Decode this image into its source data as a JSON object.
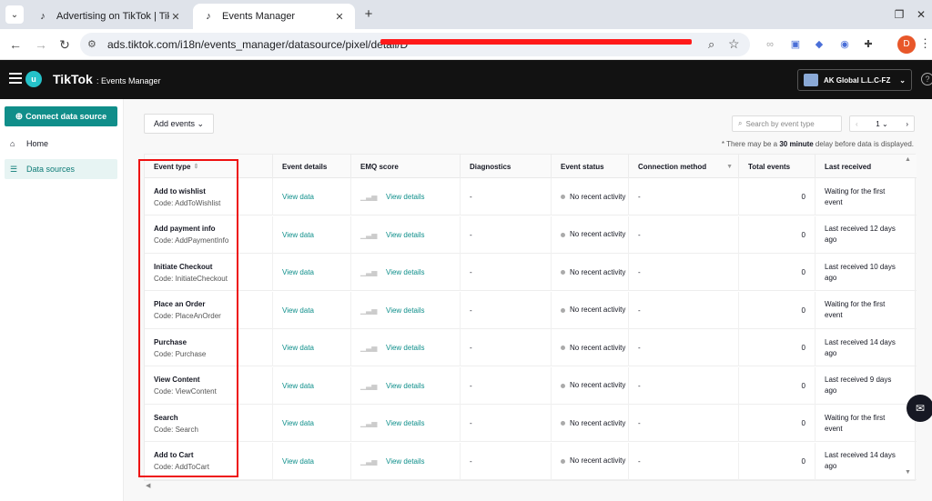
{
  "browser": {
    "tabs": [
      {
        "title": "Advertising on TikTok | TikTok A",
        "active": false
      },
      {
        "title": "Events Manager",
        "active": true
      }
    ],
    "url_host": "ads.tiktok.com",
    "url_path": "/i18n/events_manager/datasource/pixel/detail/D",
    "profile_initial": "D"
  },
  "header": {
    "brand": "TikTok",
    "brand_suffix": ": Events Manager",
    "account_name": "AK Global L.L.C-FZ"
  },
  "sidebar": {
    "connect_label": "Connect data source",
    "items": [
      {
        "label": "Home",
        "active": false
      },
      {
        "label": "Data sources",
        "active": true
      }
    ]
  },
  "toolbar": {
    "add_events_label": "Add events",
    "search_placeholder": "Search by event type",
    "page_number": "1"
  },
  "notice": {
    "prefix": "* There may be a ",
    "bold": "30 minute",
    "suffix": " delay before data is displayed."
  },
  "table": {
    "columns": [
      "Event type",
      "Event details",
      "EMQ score",
      "Diagnostics",
      "Event status",
      "Connection method",
      "Total events",
      "Last received"
    ],
    "rows": [
      {
        "name": "Add to wishlist",
        "code": "Code: AddToWishlist",
        "details": "View data",
        "emq": "View details",
        "diag": "-",
        "status": "No recent activity",
        "conn": "-",
        "total": "0",
        "last": "Waiting for the first event"
      },
      {
        "name": "Add payment info",
        "code": "Code: AddPaymentInfo",
        "details": "View data",
        "emq": "View details",
        "diag": "-",
        "status": "No recent activity",
        "conn": "-",
        "total": "0",
        "last": "Last received 12 days ago"
      },
      {
        "name": "Initiate Checkout",
        "code": "Code: InitiateCheckout",
        "details": "View data",
        "emq": "View details",
        "diag": "-",
        "status": "No recent activity",
        "conn": "-",
        "total": "0",
        "last": "Last received 10 days ago"
      },
      {
        "name": "Place an Order",
        "code": "Code: PlaceAnOrder",
        "details": "View data",
        "emq": "View details",
        "diag": "-",
        "status": "No recent activity",
        "conn": "-",
        "total": "0",
        "last": "Waiting for the first event"
      },
      {
        "name": "Purchase",
        "code": "Code: Purchase",
        "details": "View data",
        "emq": "View details",
        "diag": "-",
        "status": "No recent activity",
        "conn": "-",
        "total": "0",
        "last": "Last received 14 days ago"
      },
      {
        "name": "View Content",
        "code": "Code: ViewContent",
        "details": "View data",
        "emq": "View details",
        "diag": "-",
        "status": "No recent activity",
        "conn": "-",
        "total": "0",
        "last": "Last received 9 days ago"
      },
      {
        "name": "Search",
        "code": "Code: Search",
        "details": "View data",
        "emq": "View details",
        "diag": "-",
        "status": "No recent activity",
        "conn": "-",
        "total": "0",
        "last": "Waiting for the first event"
      },
      {
        "name": "Add to Cart",
        "code": "Code: AddToCart",
        "details": "View data",
        "emq": "View details",
        "diag": "-",
        "status": "No recent activity",
        "conn": "-",
        "total": "0",
        "last": "Last received 14 days ago"
      }
    ]
  },
  "colors": {
    "accent": "#108e8a",
    "header_bg": "#121212",
    "highlight": "#e11111"
  }
}
